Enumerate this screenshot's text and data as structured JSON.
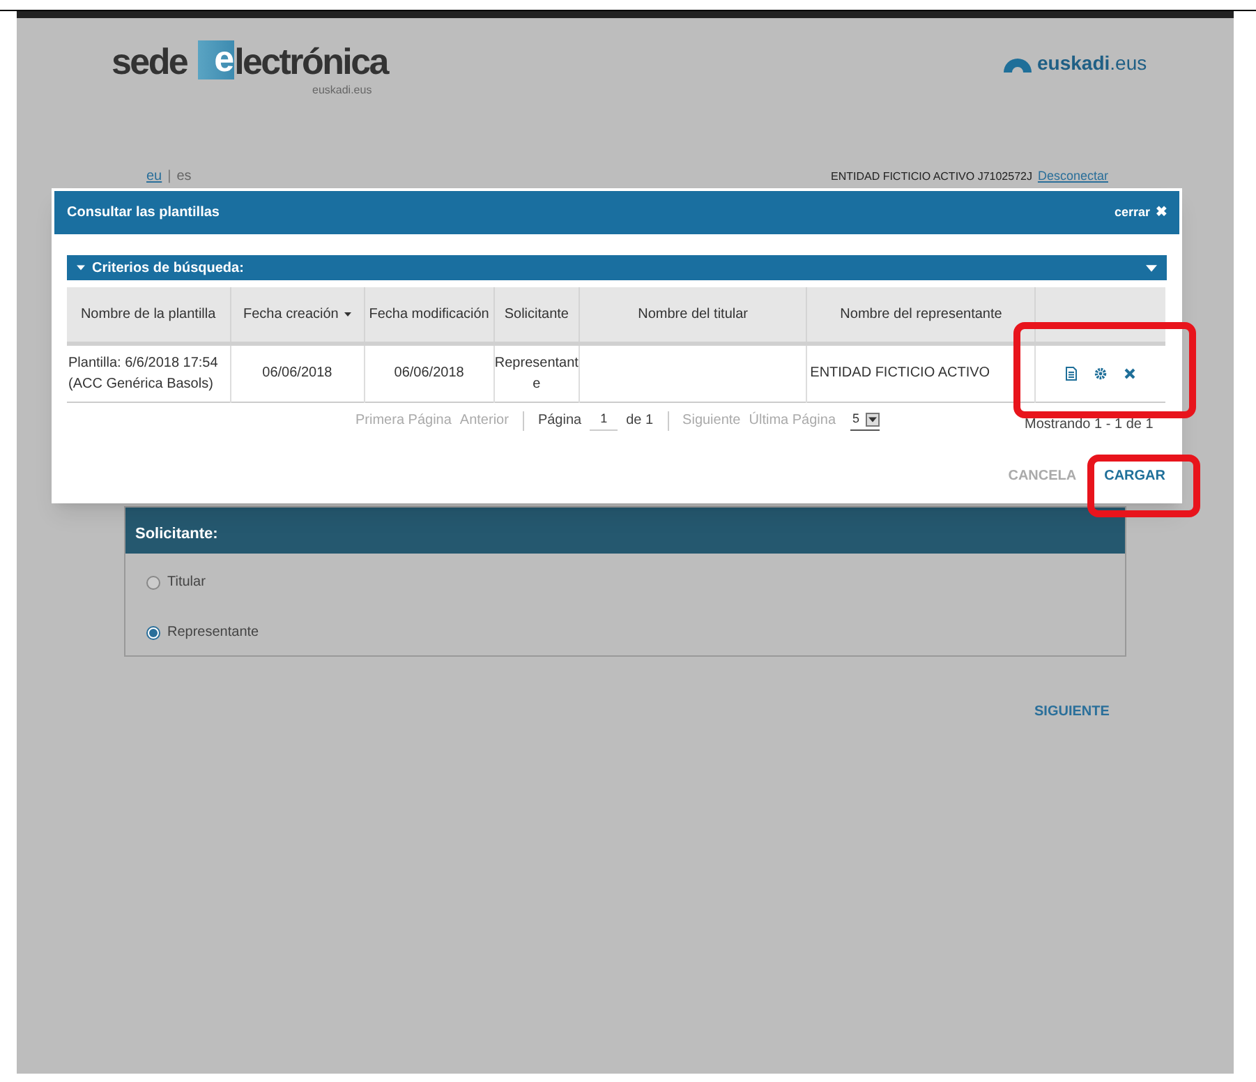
{
  "header": {
    "logo_main": "sede",
    "logo_accent": "e",
    "logo_rest": "lectrónica",
    "logo_sub": "euskadi.eus",
    "brand_bold": "euskadi",
    "brand_light": ".eus"
  },
  "lang_bar": {
    "languages": [
      {
        "label": "eu",
        "selected": false
      },
      {
        "label": "es",
        "selected": true
      }
    ],
    "separator": "|",
    "user": "ENTIDAD FICTICIO ACTIVO J7102572J",
    "logout": "Desconectar"
  },
  "modal": {
    "title": "Consultar las plantillas",
    "close": "cerrar",
    "close_glyph": "✖",
    "criteria": {
      "label": "Criterios de búsqueda:",
      "expanded": false
    },
    "table": {
      "columns": [
        {
          "label": "Nombre de la plantilla",
          "sorted": false
        },
        {
          "label": "Fecha creación",
          "sorted": true
        },
        {
          "label": "Fecha modificación",
          "sorted": false
        },
        {
          "label": "Solicitante",
          "sorted": false
        },
        {
          "label": "Nombre del titular",
          "sorted": false
        },
        {
          "label": "Nombre del representante",
          "sorted": false
        }
      ],
      "rows": [
        {
          "cells": [
            "Plantilla: 6/6/2018 17:54 (ACC Genérica Basols)",
            "06/06/2018",
            "06/06/2018",
            "Representant e",
            "",
            "ENTIDAD FICTICIO ACTIVO"
          ],
          "actions": [
            {
              "kind": "view"
            },
            {
              "kind": "settings"
            },
            {
              "kind": "delete"
            }
          ]
        }
      ]
    },
    "pager": {
      "first": "Primera Página",
      "prev": "Anterior",
      "page_label": "Página",
      "page": "1",
      "of": "de 1",
      "next": "Siguiente",
      "last": "Última Página",
      "page_size": "5",
      "showing": "Mostrando 1 - 1 de 1"
    },
    "buttons": [
      {
        "label": "CANCELA",
        "disabled": true
      },
      {
        "label": "CARGAR",
        "disabled": false
      }
    ]
  },
  "applicant": {
    "title": "Solicitante:",
    "options": [
      {
        "label": "Titular",
        "selected": false
      },
      {
        "label": "Representante",
        "selected": true
      }
    ]
  },
  "next_button": "SIGUIENTE"
}
